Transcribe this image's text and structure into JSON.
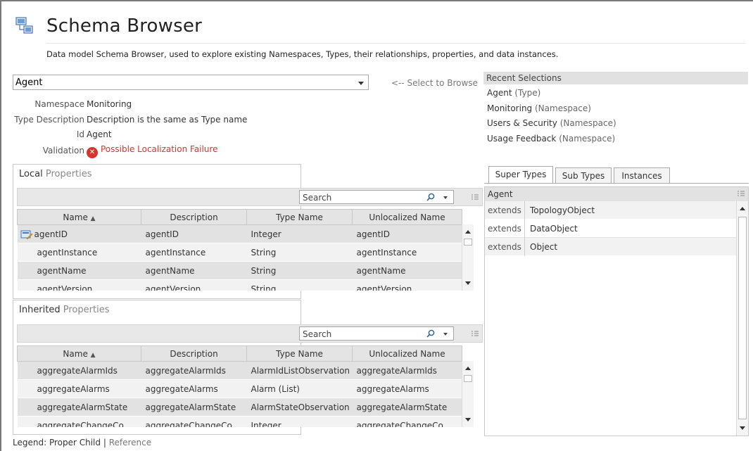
{
  "header": {
    "title": "Schema Browser",
    "subtitle": "Data model Schema Browser, used to explore existing Namespaces, Types, their relationships, properties, and data instances."
  },
  "selector": {
    "value": "Agent",
    "hint": "<-- Select to Browse"
  },
  "details": {
    "namespace_label": "Namespace",
    "namespace_value": "Monitoring",
    "description_label": "Type Description",
    "description_value": "Description is the same as Type name",
    "id_label": "Id",
    "id_value": "Agent",
    "validation_label": "Validation",
    "validation_value": "Possible Localization Failure"
  },
  "recent": {
    "header": "Recent Selections",
    "items": [
      {
        "name": "Agent",
        "kind": "(Type)"
      },
      {
        "name": "Monitoring",
        "kind": "(Namespace)"
      },
      {
        "name": "Users & Security",
        "kind": "(Namespace)"
      },
      {
        "name": "Usage Feedback",
        "kind": "(Namespace)"
      }
    ]
  },
  "local": {
    "title_strong": "Local",
    "title_muted": "Properties",
    "search_placeholder": "Search",
    "columns": [
      "Name",
      "Description",
      "Type Name",
      "Unlocalized Name"
    ],
    "rows": [
      [
        "agentID",
        "agentID",
        "Integer",
        "agentID"
      ],
      [
        "agentInstance",
        "agentInstance",
        "String",
        "agentInstance"
      ],
      [
        "agentName",
        "agentName",
        "String",
        "agentName"
      ],
      [
        "agentVersion",
        "agentVersion",
        "String",
        "agentVersion"
      ]
    ]
  },
  "inherited": {
    "title_strong": "Inherited",
    "title_muted": "Properties",
    "search_placeholder": "Search",
    "columns": [
      "Name",
      "Description",
      "Type Name",
      "Unlocalized Name"
    ],
    "rows": [
      [
        "aggregateAlarmIds",
        "aggregateAlarmIds",
        "AlarmIdListObservation",
        "aggregateAlarmIds"
      ],
      [
        "aggregateAlarms",
        "aggregateAlarms",
        "Alarm (List)",
        "aggregateAlarms"
      ],
      [
        "aggregateAlarmState",
        "aggregateAlarmState",
        "AlarmStateObservation",
        "aggregateAlarmState"
      ],
      [
        "aggregateChangeCo",
        "aggregateChangeCo",
        "Integer",
        "aggregateChangeCo"
      ]
    ]
  },
  "tabs": [
    "Super Types",
    "Sub Types",
    "Instances"
  ],
  "supertypes": {
    "header": "Agent",
    "rows": [
      {
        "kw": "extends",
        "type": "TopologyObject"
      },
      {
        "kw": "extends",
        "type": "DataObject"
      },
      {
        "kw": "extends",
        "type": "Object"
      }
    ]
  },
  "legend": {
    "prefix": "Legend: Proper Child",
    "divider": "|",
    "reference": "Reference"
  },
  "icons": {
    "app": "schema-browser-icon",
    "validation": "error-icon",
    "search": "search-icon",
    "key": "key-property-icon"
  },
  "colors": {
    "error": "#d9342b",
    "header_band": "#e2e2e2"
  }
}
